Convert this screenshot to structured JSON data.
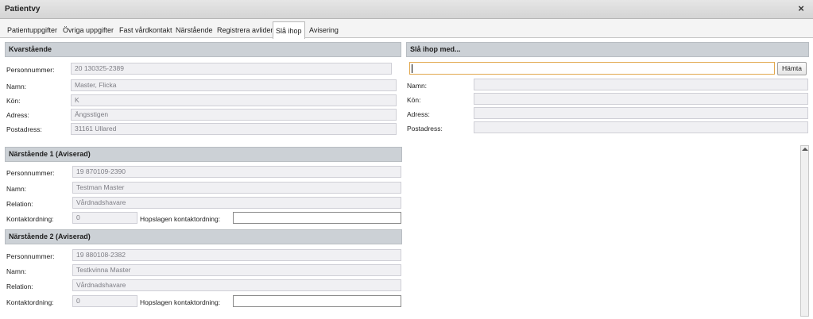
{
  "window": {
    "title": "Patientvy",
    "close_glyph": "×"
  },
  "tabs": [
    {
      "label": "Patientuppgifter"
    },
    {
      "label": "Övriga uppgifter"
    },
    {
      "label": "Fast vårdkontakt"
    },
    {
      "label": "Närstående"
    },
    {
      "label": "Registrera avliden"
    },
    {
      "label": "Slå ihop",
      "active": true
    },
    {
      "label": "Avisering"
    }
  ],
  "kvarstaende": {
    "header": "Kvarstående",
    "personnummer": {
      "label": "Personnummer:",
      "value": "20 130325-2389"
    },
    "namn": {
      "label": "Namn:",
      "value": "Master, Flicka"
    },
    "kon": {
      "label": "Kön:",
      "value": "K"
    },
    "adress": {
      "label": "Adress:",
      "value": "Ängsstigen"
    },
    "postadress": {
      "label": "Postadress:",
      "value": "31161 Ullared"
    }
  },
  "merge": {
    "header": "Slå ihop med...",
    "search_value": "",
    "fetch_label": "Hämta",
    "namn": {
      "label": "Namn:",
      "value": ""
    },
    "kon": {
      "label": "Kön:",
      "value": ""
    },
    "adress": {
      "label": "Adress:",
      "value": ""
    },
    "postadress": {
      "label": "Postadress:",
      "value": ""
    }
  },
  "related1": {
    "header": "Närstående 1 (Aviserad)",
    "personnummer": {
      "label": "Personnummer:",
      "value": "19 870109-2390"
    },
    "namn": {
      "label": "Namn:",
      "value": "Testman Master"
    },
    "relation": {
      "label": "Relation:",
      "value": "Vårdnadshavare"
    },
    "kontaktordning": {
      "label": "Kontaktordning:",
      "value": "0"
    },
    "hopslagen": {
      "label": "Hopslagen kontaktordning:",
      "value": ""
    }
  },
  "related2": {
    "header": "Närstående 2 (Aviserad)",
    "personnummer": {
      "label": "Personnummer:",
      "value": "19 880108-2382"
    },
    "namn": {
      "label": "Namn:",
      "value": "Testkvinna Master"
    },
    "relation": {
      "label": "Relation:",
      "value": "Vårdnadshavare"
    },
    "kontaktordning": {
      "label": "Kontaktordning:",
      "value": "0"
    },
    "hopslagen": {
      "label": "Hopslagen kontaktordning:",
      "value": ""
    }
  }
}
